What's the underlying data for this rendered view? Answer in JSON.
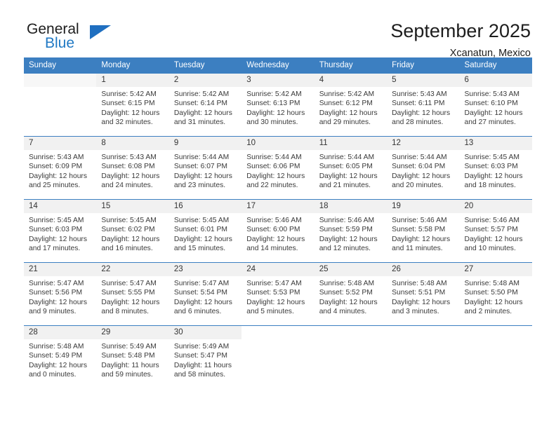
{
  "brand": {
    "name_part1": "General",
    "name_part2": "Blue",
    "logo_icon": "triangle-logo-icon"
  },
  "header": {
    "title": "September 2025",
    "subtitle": "Xcanatun, Mexico"
  },
  "calendar": {
    "weekday_headers": [
      "Sunday",
      "Monday",
      "Tuesday",
      "Wednesday",
      "Thursday",
      "Friday",
      "Saturday"
    ],
    "accent_color": "#3c7fc1",
    "daynum_bg": "#f1f1f1",
    "weeks": [
      [
        {
          "day": "",
          "sunrise": "",
          "sunset": "",
          "daylight_line1": "",
          "daylight_line2": "",
          "empty": true
        },
        {
          "day": "1",
          "sunrise": "Sunrise: 5:42 AM",
          "sunset": "Sunset: 6:15 PM",
          "daylight_line1": "Daylight: 12 hours",
          "daylight_line2": "and 32 minutes."
        },
        {
          "day": "2",
          "sunrise": "Sunrise: 5:42 AM",
          "sunset": "Sunset: 6:14 PM",
          "daylight_line1": "Daylight: 12 hours",
          "daylight_line2": "and 31 minutes."
        },
        {
          "day": "3",
          "sunrise": "Sunrise: 5:42 AM",
          "sunset": "Sunset: 6:13 PM",
          "daylight_line1": "Daylight: 12 hours",
          "daylight_line2": "and 30 minutes."
        },
        {
          "day": "4",
          "sunrise": "Sunrise: 5:42 AM",
          "sunset": "Sunset: 6:12 PM",
          "daylight_line1": "Daylight: 12 hours",
          "daylight_line2": "and 29 minutes."
        },
        {
          "day": "5",
          "sunrise": "Sunrise: 5:43 AM",
          "sunset": "Sunset: 6:11 PM",
          "daylight_line1": "Daylight: 12 hours",
          "daylight_line2": "and 28 minutes."
        },
        {
          "day": "6",
          "sunrise": "Sunrise: 5:43 AM",
          "sunset": "Sunset: 6:10 PM",
          "daylight_line1": "Daylight: 12 hours",
          "daylight_line2": "and 27 minutes."
        }
      ],
      [
        {
          "day": "7",
          "sunrise": "Sunrise: 5:43 AM",
          "sunset": "Sunset: 6:09 PM",
          "daylight_line1": "Daylight: 12 hours",
          "daylight_line2": "and 25 minutes."
        },
        {
          "day": "8",
          "sunrise": "Sunrise: 5:43 AM",
          "sunset": "Sunset: 6:08 PM",
          "daylight_line1": "Daylight: 12 hours",
          "daylight_line2": "and 24 minutes."
        },
        {
          "day": "9",
          "sunrise": "Sunrise: 5:44 AM",
          "sunset": "Sunset: 6:07 PM",
          "daylight_line1": "Daylight: 12 hours",
          "daylight_line2": "and 23 minutes."
        },
        {
          "day": "10",
          "sunrise": "Sunrise: 5:44 AM",
          "sunset": "Sunset: 6:06 PM",
          "daylight_line1": "Daylight: 12 hours",
          "daylight_line2": "and 22 minutes."
        },
        {
          "day": "11",
          "sunrise": "Sunrise: 5:44 AM",
          "sunset": "Sunset: 6:05 PM",
          "daylight_line1": "Daylight: 12 hours",
          "daylight_line2": "and 21 minutes."
        },
        {
          "day": "12",
          "sunrise": "Sunrise: 5:44 AM",
          "sunset": "Sunset: 6:04 PM",
          "daylight_line1": "Daylight: 12 hours",
          "daylight_line2": "and 20 minutes."
        },
        {
          "day": "13",
          "sunrise": "Sunrise: 5:45 AM",
          "sunset": "Sunset: 6:03 PM",
          "daylight_line1": "Daylight: 12 hours",
          "daylight_line2": "and 18 minutes."
        }
      ],
      [
        {
          "day": "14",
          "sunrise": "Sunrise: 5:45 AM",
          "sunset": "Sunset: 6:03 PM",
          "daylight_line1": "Daylight: 12 hours",
          "daylight_line2": "and 17 minutes."
        },
        {
          "day": "15",
          "sunrise": "Sunrise: 5:45 AM",
          "sunset": "Sunset: 6:02 PM",
          "daylight_line1": "Daylight: 12 hours",
          "daylight_line2": "and 16 minutes."
        },
        {
          "day": "16",
          "sunrise": "Sunrise: 5:45 AM",
          "sunset": "Sunset: 6:01 PM",
          "daylight_line1": "Daylight: 12 hours",
          "daylight_line2": "and 15 minutes."
        },
        {
          "day": "17",
          "sunrise": "Sunrise: 5:46 AM",
          "sunset": "Sunset: 6:00 PM",
          "daylight_line1": "Daylight: 12 hours",
          "daylight_line2": "and 14 minutes."
        },
        {
          "day": "18",
          "sunrise": "Sunrise: 5:46 AM",
          "sunset": "Sunset: 5:59 PM",
          "daylight_line1": "Daylight: 12 hours",
          "daylight_line2": "and 12 minutes."
        },
        {
          "day": "19",
          "sunrise": "Sunrise: 5:46 AM",
          "sunset": "Sunset: 5:58 PM",
          "daylight_line1": "Daylight: 12 hours",
          "daylight_line2": "and 11 minutes."
        },
        {
          "day": "20",
          "sunrise": "Sunrise: 5:46 AM",
          "sunset": "Sunset: 5:57 PM",
          "daylight_line1": "Daylight: 12 hours",
          "daylight_line2": "and 10 minutes."
        }
      ],
      [
        {
          "day": "21",
          "sunrise": "Sunrise: 5:47 AM",
          "sunset": "Sunset: 5:56 PM",
          "daylight_line1": "Daylight: 12 hours",
          "daylight_line2": "and 9 minutes."
        },
        {
          "day": "22",
          "sunrise": "Sunrise: 5:47 AM",
          "sunset": "Sunset: 5:55 PM",
          "daylight_line1": "Daylight: 12 hours",
          "daylight_line2": "and 8 minutes."
        },
        {
          "day": "23",
          "sunrise": "Sunrise: 5:47 AM",
          "sunset": "Sunset: 5:54 PM",
          "daylight_line1": "Daylight: 12 hours",
          "daylight_line2": "and 6 minutes."
        },
        {
          "day": "24",
          "sunrise": "Sunrise: 5:47 AM",
          "sunset": "Sunset: 5:53 PM",
          "daylight_line1": "Daylight: 12 hours",
          "daylight_line2": "and 5 minutes."
        },
        {
          "day": "25",
          "sunrise": "Sunrise: 5:48 AM",
          "sunset": "Sunset: 5:52 PM",
          "daylight_line1": "Daylight: 12 hours",
          "daylight_line2": "and 4 minutes."
        },
        {
          "day": "26",
          "sunrise": "Sunrise: 5:48 AM",
          "sunset": "Sunset: 5:51 PM",
          "daylight_line1": "Daylight: 12 hours",
          "daylight_line2": "and 3 minutes."
        },
        {
          "day": "27",
          "sunrise": "Sunrise: 5:48 AM",
          "sunset": "Sunset: 5:50 PM",
          "daylight_line1": "Daylight: 12 hours",
          "daylight_line2": "and 2 minutes."
        }
      ],
      [
        {
          "day": "28",
          "sunrise": "Sunrise: 5:48 AM",
          "sunset": "Sunset: 5:49 PM",
          "daylight_line1": "Daylight: 12 hours",
          "daylight_line2": "and 0 minutes."
        },
        {
          "day": "29",
          "sunrise": "Sunrise: 5:49 AM",
          "sunset": "Sunset: 5:48 PM",
          "daylight_line1": "Daylight: 11 hours",
          "daylight_line2": "and 59 minutes."
        },
        {
          "day": "30",
          "sunrise": "Sunrise: 5:49 AM",
          "sunset": "Sunset: 5:47 PM",
          "daylight_line1": "Daylight: 11 hours",
          "daylight_line2": "and 58 minutes."
        },
        {
          "day": "",
          "sunrise": "",
          "sunset": "",
          "daylight_line1": "",
          "daylight_line2": "",
          "empty": true,
          "blank": true
        },
        {
          "day": "",
          "sunrise": "",
          "sunset": "",
          "daylight_line1": "",
          "daylight_line2": "",
          "empty": true,
          "blank": true
        },
        {
          "day": "",
          "sunrise": "",
          "sunset": "",
          "daylight_line1": "",
          "daylight_line2": "",
          "empty": true,
          "blank": true
        },
        {
          "day": "",
          "sunrise": "",
          "sunset": "",
          "daylight_line1": "",
          "daylight_line2": "",
          "empty": true,
          "blank": true
        }
      ]
    ]
  }
}
